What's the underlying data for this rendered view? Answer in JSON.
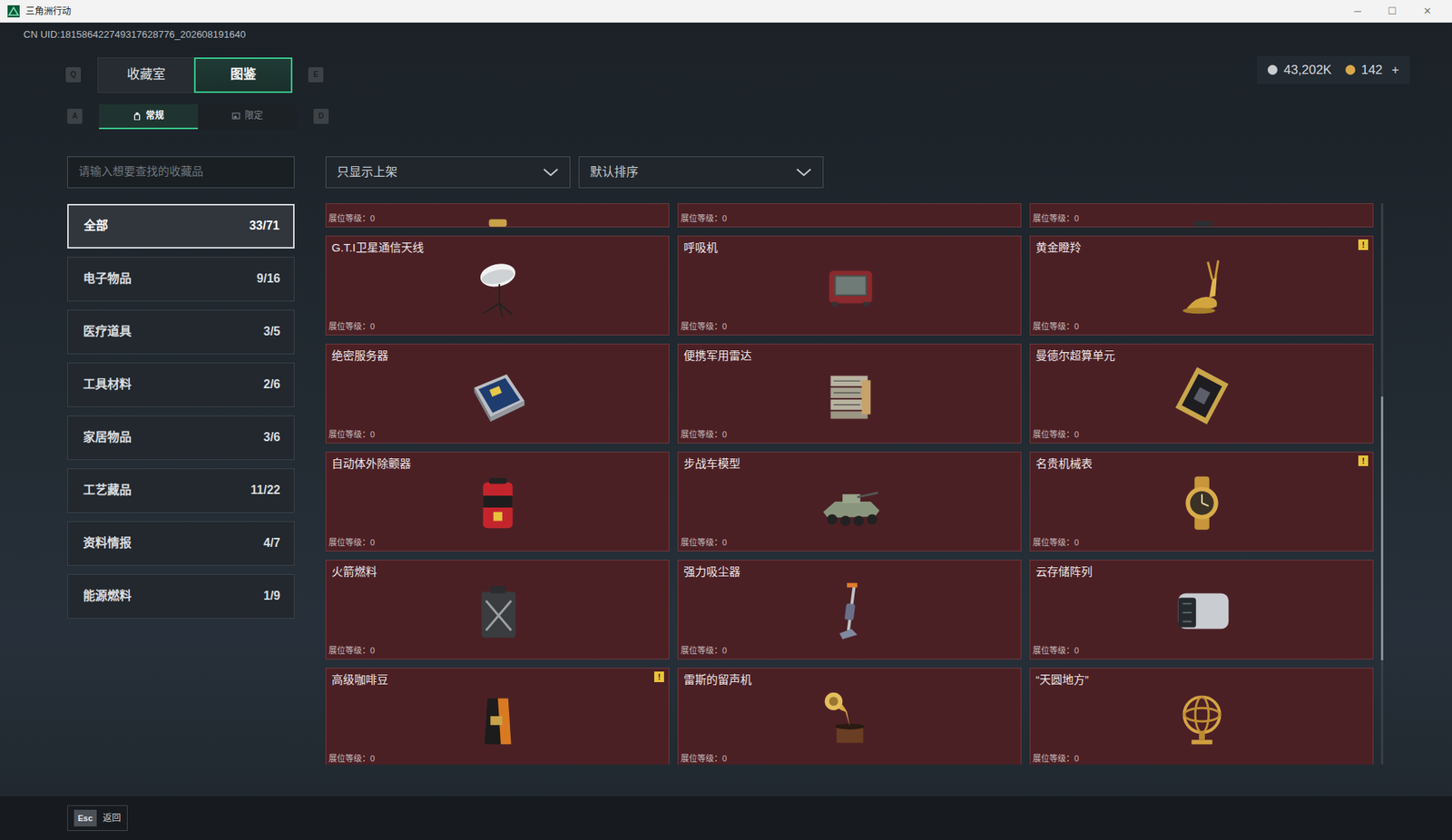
{
  "window": {
    "title": "三角洲行动",
    "controls": [
      "─",
      "☐",
      "✕"
    ]
  },
  "uid": "CN UID:181586422749317628776_202608191640",
  "currency": [
    {
      "value": "43,202K",
      "color": "#c9ccd0"
    },
    {
      "value": "142",
      "color": "#d9a84a"
    }
  ],
  "currency_add": "+",
  "tabs": {
    "key_prev": "Q",
    "key_next": "E",
    "items": [
      {
        "label": "收藏室",
        "selected": false
      },
      {
        "label": "图鉴",
        "selected": true
      }
    ]
  },
  "subtabs": {
    "key_prev": "A",
    "key_next": "D",
    "items": [
      {
        "label": "常规",
        "selected": true
      },
      {
        "label": "限定",
        "selected": false
      }
    ]
  },
  "search": {
    "placeholder": "请输入想要查找的收藏品"
  },
  "filters": [
    {
      "label": "只显示上架"
    },
    {
      "label": "默认排序"
    }
  ],
  "categories": [
    {
      "name": "全部",
      "count": "33/71",
      "selected": true
    },
    {
      "name": "电子物品",
      "count": "9/16",
      "selected": false
    },
    {
      "name": "医疗道具",
      "count": "3/5",
      "selected": false
    },
    {
      "name": "工具材料",
      "count": "2/6",
      "selected": false
    },
    {
      "name": "家居物品",
      "count": "3/6",
      "selected": false
    },
    {
      "name": "工艺藏品",
      "count": "11/22",
      "selected": false
    },
    {
      "name": "资料情报",
      "count": "4/7",
      "selected": false
    },
    {
      "name": "能源燃料",
      "count": "1/9",
      "selected": false
    }
  ],
  "grid": {
    "alert_glyph": "!",
    "partial_row": [
      {
        "level": "展位等级：0"
      },
      {
        "level": "展位等级：0"
      },
      {
        "level": "展位等级：0"
      }
    ],
    "cards": [
      {
        "name": "G.T.I卫星通信天线",
        "level": "展位等级：0",
        "alert": false
      },
      {
        "name": "呼吸机",
        "level": "展位等级：0",
        "alert": false
      },
      {
        "name": "黄金瞪羚",
        "level": "展位等级：0",
        "alert": true
      },
      {
        "name": "绝密服务器",
        "level": "展位等级：0",
        "alert": false
      },
      {
        "name": "便携军用雷达",
        "level": "展位等级：0",
        "alert": false
      },
      {
        "name": "曼德尔超算单元",
        "level": "展位等级：0",
        "alert": false
      },
      {
        "name": "自动体外除颤器",
        "level": "展位等级：0",
        "alert": false
      },
      {
        "name": "步战车模型",
        "level": "展位等级：0",
        "alert": false
      },
      {
        "name": "名贵机械表",
        "level": "展位等级：0",
        "alert": true
      },
      {
        "name": "火箭燃料",
        "level": "展位等级：0",
        "alert": false
      },
      {
        "name": "强力吸尘器",
        "level": "展位等级：0",
        "alert": false
      },
      {
        "name": "云存储阵列",
        "level": "展位等级：0",
        "alert": false
      },
      {
        "name": "高级咖啡豆",
        "level": "展位等级：0",
        "alert": true
      },
      {
        "name": "雷斯的留声机",
        "level": "展位等级：0",
        "alert": false
      },
      {
        "name": "“天圆地方”",
        "level": "展位等级：0",
        "alert": false
      }
    ]
  },
  "scrollbar": {
    "thumb_start": 0.345,
    "thumb_size": 0.47
  },
  "footer": {
    "key": "Esc",
    "label": "返回"
  }
}
